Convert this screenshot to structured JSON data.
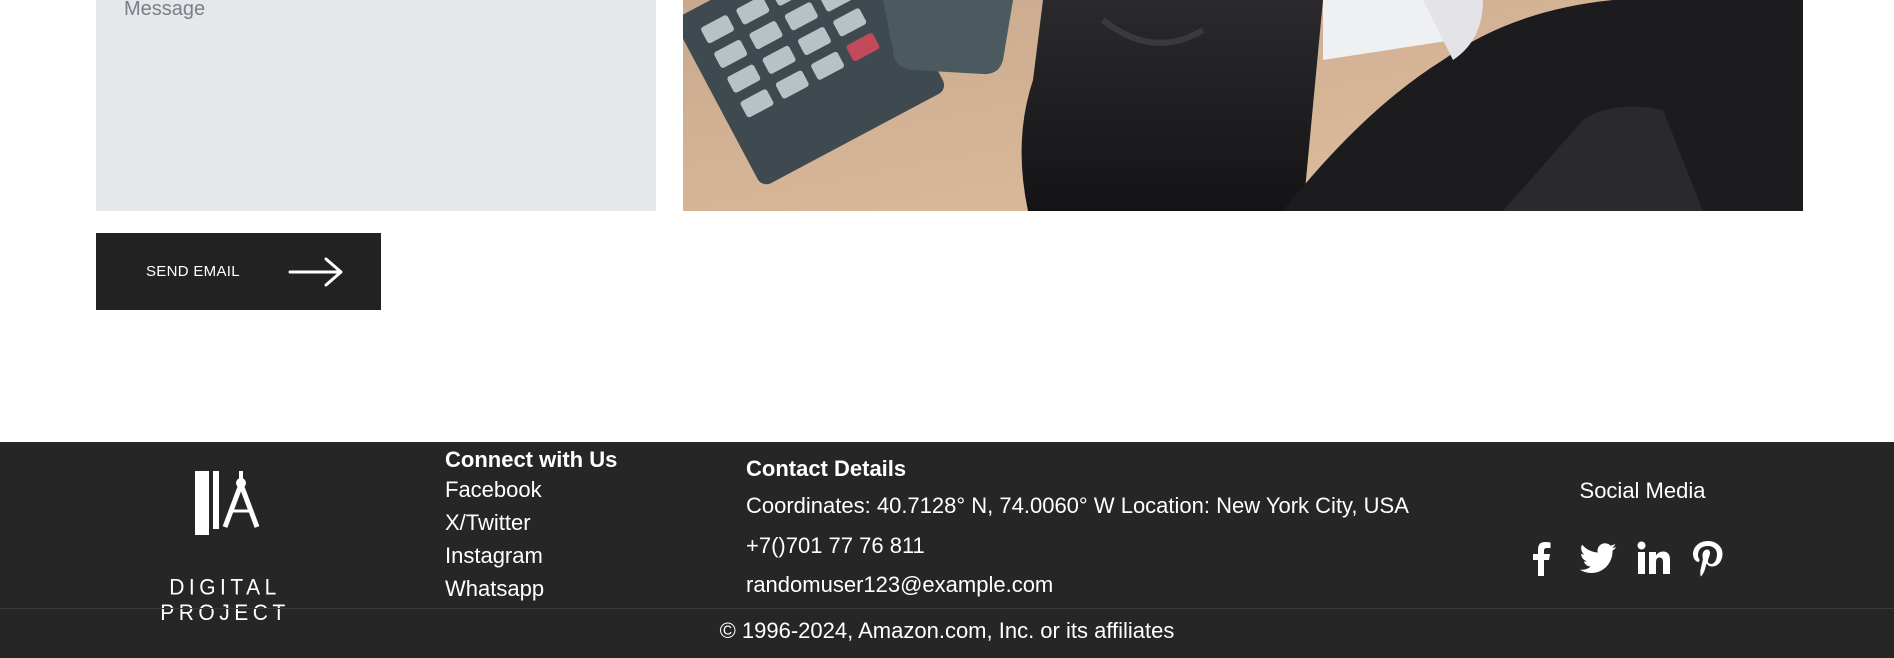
{
  "form": {
    "message_placeholder": "Message",
    "send_label": "SEND EMAIL"
  },
  "footer": {
    "logo_text": "DIGITAL PROJECT",
    "connect": {
      "title": "Connect with Us",
      "links": [
        "Facebook",
        "X/Twitter",
        "Instagram",
        "Whatsapp"
      ]
    },
    "contact": {
      "title": "Contact Details",
      "coordinates": "Coordinates: 40.7128° N, 74.0060° W Location: New York City, USA",
      "phone": "+7()701 77 76 811",
      "email": "randomuser123@example.com"
    },
    "social": {
      "title": "Social Media",
      "icons": [
        "facebook-icon",
        "twitter-icon",
        "linkedin-icon",
        "pinterest-icon"
      ]
    },
    "copyright": "© 1996-2024, Amazon.com, Inc. or its affiliates"
  },
  "colors": {
    "footer_bg": "#262626",
    "button_bg": "#222222",
    "input_bg": "#e6e7ea"
  }
}
